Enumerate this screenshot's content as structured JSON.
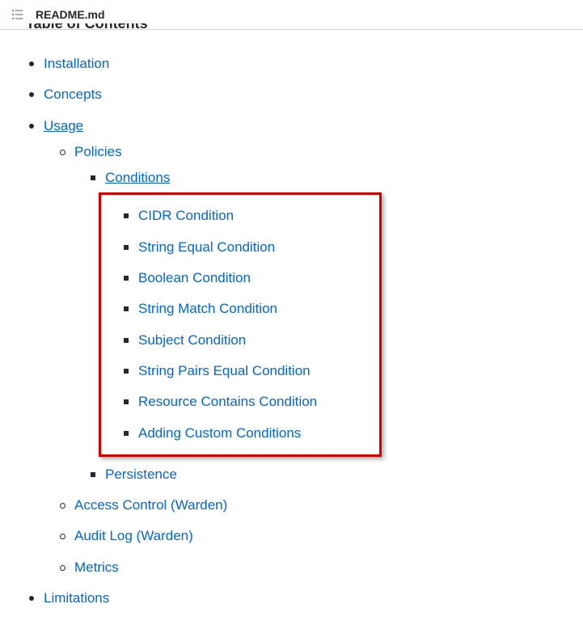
{
  "header": {
    "filename": "README.md"
  },
  "title": "Table of Contents",
  "toc": {
    "installation": "Installation",
    "concepts": "Concepts",
    "usage": "Usage",
    "policies": "Policies",
    "conditions": "Conditions",
    "cond_cidr": "CIDR Condition",
    "cond_string_equal": "String Equal Condition",
    "cond_boolean": "Boolean Condition",
    "cond_string_match": "String Match Condition",
    "cond_subject": "Subject Condition",
    "cond_string_pairs": "String Pairs Equal Condition",
    "cond_resource_contains": "Resource Contains Condition",
    "cond_adding_custom": "Adding Custom Conditions",
    "persistence": "Persistence",
    "access_control": "Access Control (Warden)",
    "audit_log": "Audit Log (Warden)",
    "metrics": "Metrics",
    "limitations": "Limitations"
  }
}
